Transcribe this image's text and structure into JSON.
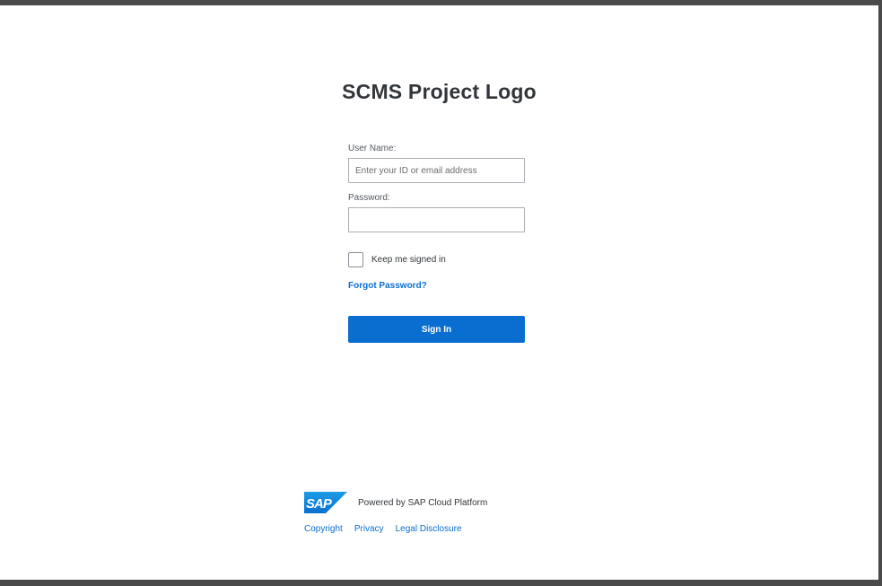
{
  "page": {
    "background_color": "#ffffff",
    "frame_color": "#4a4a4a"
  },
  "header": {
    "logo_text": "SCMS Project Logo"
  },
  "login": {
    "username_label": "User Name:",
    "username_placeholder": "Enter your ID or email address",
    "username_value": "",
    "password_label": "Password:",
    "password_value": "",
    "remember_label": "Keep me signed in",
    "remember_checked": false,
    "forgot_label": "Forgot Password?",
    "signin_label": "Sign In",
    "accent_color": "#0a6ed1"
  },
  "footer": {
    "logo_icon": "sap-logo-icon",
    "powered_text": "Powered by SAP Cloud Platform",
    "links": [
      {
        "label": "Copyright"
      },
      {
        "label": "Privacy"
      },
      {
        "label": "Legal Disclosure"
      }
    ]
  }
}
